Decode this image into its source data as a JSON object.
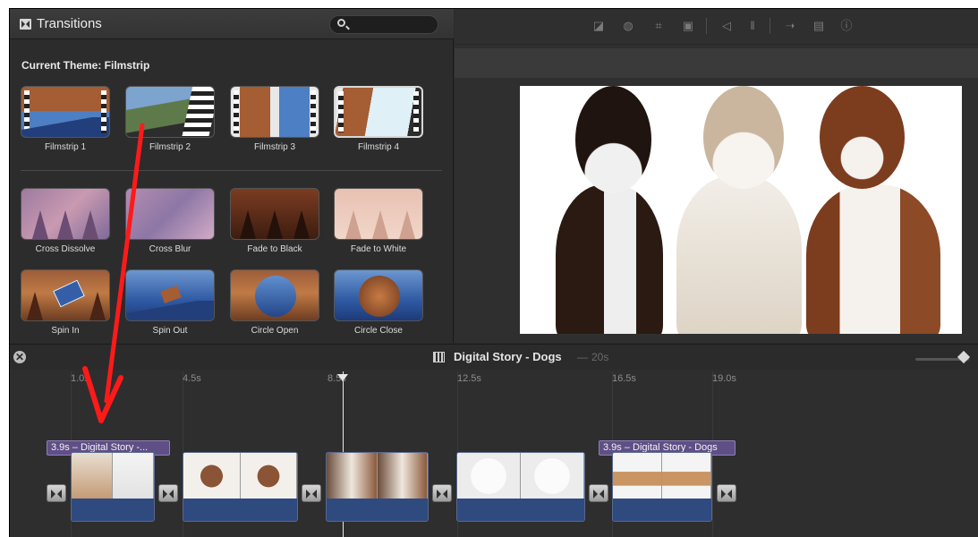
{
  "browser": {
    "title": "Transitions",
    "search_placeholder": "",
    "theme_heading": "Current Theme: Filmstrip",
    "theme_transitions": [
      {
        "label": "Filmstrip 1"
      },
      {
        "label": "Filmstrip 2"
      },
      {
        "label": "Filmstrip 3"
      },
      {
        "label": "Filmstrip 4"
      }
    ],
    "standard_transitions": [
      {
        "label": "Cross Dissolve"
      },
      {
        "label": "Cross Blur"
      },
      {
        "label": "Fade to Black"
      },
      {
        "label": "Fade to White"
      },
      {
        "label": "Spin In"
      },
      {
        "label": "Spin Out"
      },
      {
        "label": "Circle Open"
      },
      {
        "label": "Circle Close"
      }
    ]
  },
  "viewer": {
    "toolbar_icons": [
      "color-balance-icon",
      "color-correction-icon",
      "crop-icon",
      "stabilization-icon",
      "volume-icon",
      "equalizer-icon",
      "speed-icon",
      "clip-filter-icon",
      "info-icon"
    ]
  },
  "timeline": {
    "project_title": "Digital Story - Dogs",
    "project_dash": "—",
    "project_duration": "20s",
    "ticks": [
      "1.0s",
      "4.5s",
      "8.5s",
      "12.5s",
      "16.5s",
      "19.0s"
    ],
    "title_bars": [
      "3.9s – Digital Story -...",
      "3.9s – Digital Story - Dogs"
    ]
  },
  "colors": {
    "annotation_arrow": "#ff1a1a",
    "title_bar": "#5f4f86",
    "audio_track": "#2f4a7e"
  }
}
